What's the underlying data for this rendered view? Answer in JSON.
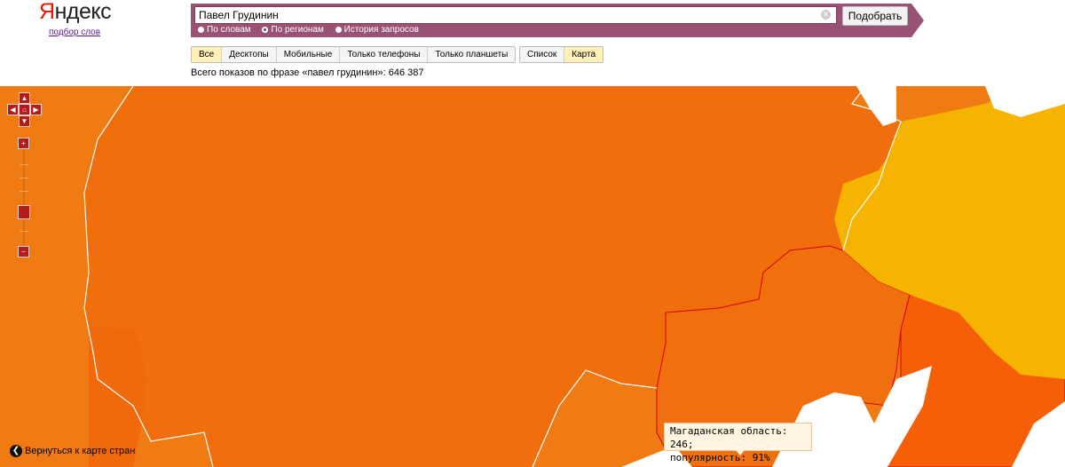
{
  "app": {
    "logo": "Яндекс",
    "sublogo": "подбор слов"
  },
  "search": {
    "value": "Павел Грудинин",
    "button_label": "Подобрать"
  },
  "modes": [
    {
      "label": "По словам",
      "selected": false
    },
    {
      "label": "По регионам",
      "selected": true
    },
    {
      "label": "История запросов",
      "selected": false
    }
  ],
  "device_tabs": [
    {
      "label": "Все",
      "active": true
    },
    {
      "label": "Десктопы",
      "active": false
    },
    {
      "label": "Мобильные",
      "active": false
    },
    {
      "label": "Только телефоны",
      "active": false
    },
    {
      "label": "Только планшеты",
      "active": false
    }
  ],
  "view_tabs": [
    {
      "label": "Список",
      "active": false
    },
    {
      "label": "Карта",
      "active": true
    }
  ],
  "summary": {
    "text": "Всего показов по фразе «павел грудинин»: 646 387"
  },
  "map": {
    "colors": {
      "base": "#f07b12",
      "high": "#f46a08",
      "low": "#f6b300",
      "border": "#ffffff",
      "region_border": "#d40000"
    },
    "tooltip": {
      "line1": "Магаданская область: 246;",
      "line2": "популярность: 91%"
    },
    "back_label": "Вернуться к карте стран",
    "icons": {
      "pan_up": "chevron-up-icon",
      "pan_down": "chevron-down-icon",
      "pan_left": "chevron-left-icon",
      "pan_right": "chevron-right-icon",
      "home": "home-icon",
      "zoom_in": "plus-icon",
      "zoom_out": "minus-icon",
      "back": "arrow-left-icon"
    }
  }
}
